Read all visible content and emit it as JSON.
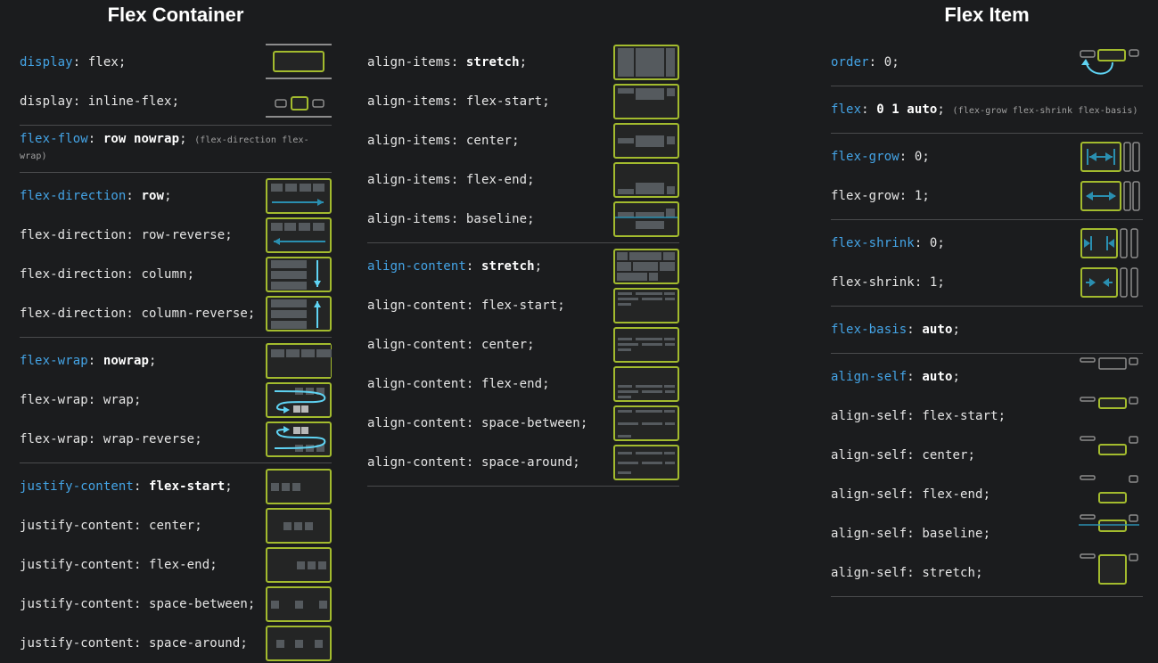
{
  "headings": {
    "container": "Flex Container",
    "item": "Flex Item"
  },
  "colors": {
    "background": "#1b1c1e",
    "text": "#e6e6e6",
    "property_highlight": "#44a4e6",
    "box_border": "#a3bb2e",
    "box_fill": "#242525",
    "block": "#555a5e",
    "arrow": "#2a8fb0"
  },
  "col1": {
    "display": [
      {
        "prop": "display",
        "value": "flex",
        "icon": "display-flex-icon"
      },
      {
        "prop": "display",
        "value": "inline-flex",
        "icon": "display-inline-flex-icon"
      }
    ],
    "flow": {
      "prop": "flex-flow",
      "value": "row nowrap",
      "note": "(flex-direction flex-wrap)",
      "icon": ""
    },
    "direction": [
      {
        "prop": "flex-direction",
        "value": "row",
        "icon": "arrow-right-icon"
      },
      {
        "prop": "flex-direction",
        "value": "row-reverse",
        "icon": "arrow-left-icon"
      },
      {
        "prop": "flex-direction",
        "value": "column",
        "icon": "arrow-down-icon"
      },
      {
        "prop": "flex-direction",
        "value": "column-reverse",
        "icon": "arrow-up-icon"
      }
    ],
    "wrap": [
      {
        "prop": "flex-wrap",
        "value": "nowrap",
        "icon": "nowrap-icon"
      },
      {
        "prop": "flex-wrap",
        "value": "wrap",
        "icon": "wrap-icon"
      },
      {
        "prop": "flex-wrap",
        "value": "wrap-reverse",
        "icon": "wrap-reverse-icon"
      }
    ],
    "justify": [
      {
        "prop": "justify-content",
        "value": "flex-start",
        "icon": "justify-start-icon"
      },
      {
        "prop": "justify-content",
        "value": "center",
        "icon": "justify-center-icon"
      },
      {
        "prop": "justify-content",
        "value": "flex-end",
        "icon": "justify-end-icon"
      },
      {
        "prop": "justify-content",
        "value": "space-between",
        "icon": "justify-between-icon"
      },
      {
        "prop": "justify-content",
        "value": "space-around",
        "icon": "justify-around-icon"
      }
    ]
  },
  "col2": {
    "align_items": [
      {
        "prop": "align-items",
        "value": "stretch",
        "icon": "align-items-stretch-icon"
      },
      {
        "prop": "align-items",
        "value": "flex-start",
        "icon": "align-items-start-icon"
      },
      {
        "prop": "align-items",
        "value": "center",
        "icon": "align-items-center-icon"
      },
      {
        "prop": "align-items",
        "value": "flex-end",
        "icon": "align-items-end-icon"
      },
      {
        "prop": "align-items",
        "value": "baseline",
        "icon": "align-items-baseline-icon"
      }
    ],
    "align_content": [
      {
        "prop": "align-content",
        "value": "stretch",
        "icon": "align-content-stretch-icon"
      },
      {
        "prop": "align-content",
        "value": "flex-start",
        "icon": "align-content-start-icon"
      },
      {
        "prop": "align-content",
        "value": "center",
        "icon": "align-content-center-icon"
      },
      {
        "prop": "align-content",
        "value": "flex-end",
        "icon": "align-content-end-icon"
      },
      {
        "prop": "align-content",
        "value": "space-between",
        "icon": "align-content-between-icon"
      },
      {
        "prop": "align-content",
        "value": "space-around",
        "icon": "align-content-around-icon"
      }
    ]
  },
  "col3": {
    "order": {
      "prop": "order",
      "value": "0",
      "icon": "order-icon"
    },
    "flex": {
      "prop": "flex",
      "value": "0 1 auto",
      "note": "(flex-grow flex-shrink flex-basis)",
      "icon": ""
    },
    "grow": [
      {
        "prop": "flex-grow",
        "value": "0",
        "icon": "flex-grow-0-icon"
      },
      {
        "prop": "flex-grow",
        "value": "1",
        "icon": "flex-grow-1-icon"
      }
    ],
    "shrink": [
      {
        "prop": "flex-shrink",
        "value": "0",
        "icon": "flex-shrink-0-icon"
      },
      {
        "prop": "flex-shrink",
        "value": "1",
        "icon": "flex-shrink-1-icon"
      }
    ],
    "basis": {
      "prop": "flex-basis",
      "value": "auto",
      "icon": ""
    },
    "align_self": [
      {
        "prop": "align-self",
        "value": "auto",
        "icon": "align-self-auto-icon"
      },
      {
        "prop": "align-self",
        "value": "flex-start",
        "icon": "align-self-start-icon"
      },
      {
        "prop": "align-self",
        "value": "center",
        "icon": "align-self-center-icon"
      },
      {
        "prop": "align-self",
        "value": "flex-end",
        "icon": "align-self-end-icon"
      },
      {
        "prop": "align-self",
        "value": "baseline",
        "icon": "align-self-baseline-icon"
      },
      {
        "prop": "align-self",
        "value": "stretch",
        "icon": "align-self-stretch-icon"
      }
    ]
  }
}
